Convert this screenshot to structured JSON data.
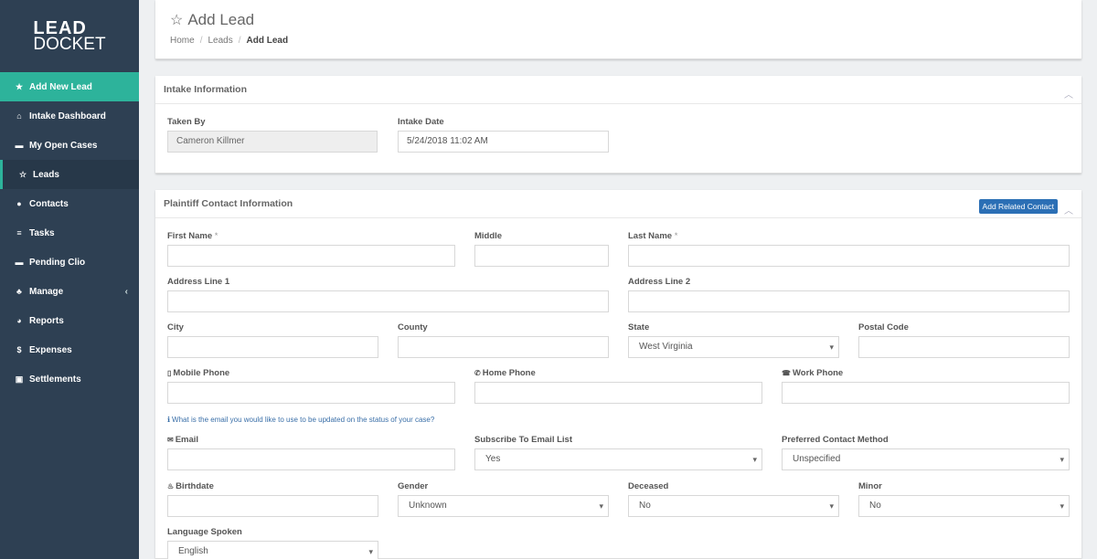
{
  "brand": {
    "logo_top": "LEAD",
    "logo_bottom": "DOCKET"
  },
  "sidebar": {
    "items": [
      {
        "label": "Add New Lead",
        "icon": "star-icon"
      },
      {
        "label": "Intake Dashboard",
        "icon": "home-icon"
      },
      {
        "label": "My Open Cases",
        "icon": "briefcase-icon"
      },
      {
        "label": "Leads",
        "icon": "star-outline-icon"
      },
      {
        "label": "Contacts",
        "icon": "user-icon"
      },
      {
        "label": "Tasks",
        "icon": "list-icon"
      },
      {
        "label": "Pending Clio",
        "icon": "briefcase-icon"
      },
      {
        "label": "Manage",
        "icon": "sitemap-icon"
      },
      {
        "label": "Reports",
        "icon": "pie-chart-icon"
      },
      {
        "label": "Expenses",
        "icon": "dollar-icon"
      },
      {
        "label": "Settlements",
        "icon": "money-icon"
      }
    ]
  },
  "header": {
    "title": "Add Lead",
    "breadcrumb": [
      "Home",
      "Leads",
      "Add Lead"
    ]
  },
  "intake": {
    "title": "Intake Information",
    "taken_by_label": "Taken By",
    "taken_by_value": "Cameron Killmer",
    "intake_date_label": "Intake Date",
    "intake_date_value": "5/24/2018 11:02 AM"
  },
  "plaintiff": {
    "title": "Plaintiff Contact Information",
    "add_related_label": "Add Related Contact",
    "first_name_label": "First Name",
    "middle_label": "Middle",
    "last_name_label": "Last Name",
    "required_mark": "*",
    "address1_label": "Address Line 1",
    "address2_label": "Address Line 2",
    "city_label": "City",
    "county_label": "County",
    "state_label": "State",
    "state_value": "West Virginia",
    "postal_label": "Postal Code",
    "mobile_label": "Mobile Phone",
    "home_label": "Home Phone",
    "work_label": "Work Phone",
    "email_hint": "What is the email you would like to use to be updated on the status of your case?",
    "email_label": "Email",
    "subscribe_label": "Subscribe To Email List",
    "subscribe_value": "Yes",
    "preferred_label": "Preferred Contact Method",
    "preferred_value": "Unspecified",
    "birthdate_label": "Birthdate",
    "gender_label": "Gender",
    "gender_value": "Unknown",
    "deceased_label": "Deceased",
    "deceased_value": "No",
    "minor_label": "Minor",
    "minor_value": "No",
    "language_label": "Language Spoken",
    "language_value": "English"
  },
  "colors": {
    "sidebar": "#2e4053",
    "accent": "#2db39b",
    "button": "#2b6fb5"
  }
}
